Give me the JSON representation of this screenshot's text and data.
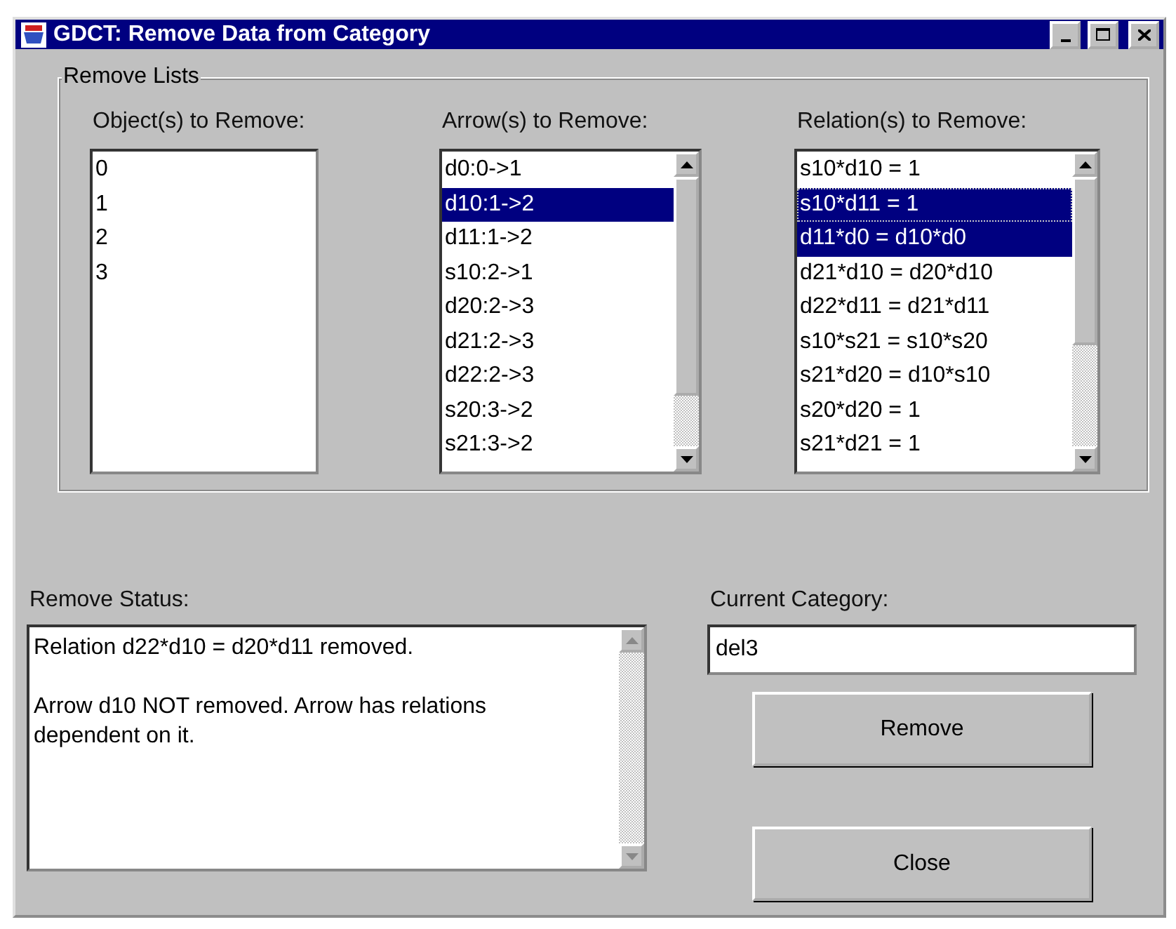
{
  "window": {
    "title": "GDCT: Remove Data from Category"
  },
  "remove_lists": {
    "title": "Remove Lists",
    "objects": {
      "label": "Object(s) to Remove:",
      "items": [
        {
          "text": "0",
          "selected": false
        },
        {
          "text": "1",
          "selected": false
        },
        {
          "text": "2",
          "selected": false
        },
        {
          "text": "3",
          "selected": false
        }
      ]
    },
    "arrows": {
      "label": "Arrow(s) to Remove:",
      "items": [
        {
          "text": "d0:0->1",
          "selected": false
        },
        {
          "text": "d10:1->2",
          "selected": true
        },
        {
          "text": "d11:1->2",
          "selected": false
        },
        {
          "text": "s10:2->1",
          "selected": false
        },
        {
          "text": "d20:2->3",
          "selected": false
        },
        {
          "text": "d21:2->3",
          "selected": false
        },
        {
          "text": "d22:2->3",
          "selected": false
        },
        {
          "text": "s20:3->2",
          "selected": false
        },
        {
          "text": "s21:3->2",
          "selected": false
        }
      ]
    },
    "relations": {
      "label": "Relation(s) to Remove:",
      "items": [
        {
          "text": "s10*d10 = 1",
          "selected": false,
          "focused": false
        },
        {
          "text": "s10*d11 = 1",
          "selected": true,
          "focused": true
        },
        {
          "text": "d11*d0 = d10*d0",
          "selected": true,
          "focused": false
        },
        {
          "text": "d21*d10 = d20*d10",
          "selected": false,
          "focused": false
        },
        {
          "text": "d22*d11 = d21*d11",
          "selected": false,
          "focused": false
        },
        {
          "text": "s10*s21 = s10*s20",
          "selected": false,
          "focused": false
        },
        {
          "text": "s21*d20 = d10*s10",
          "selected": false,
          "focused": false
        },
        {
          "text": "s20*d20 = 1",
          "selected": false,
          "focused": false
        },
        {
          "text": "s21*d21 = 1",
          "selected": false,
          "focused": false
        }
      ]
    }
  },
  "remove_status": {
    "label": "Remove Status:",
    "paragraphs": [
      "Relation d22*d10 = d20*d11 removed.",
      "Arrow d10 NOT removed. Arrow has relations dependent on it."
    ]
  },
  "current_category": {
    "label": "Current Category:",
    "value": "del3"
  },
  "buttons": [
    "Remove",
    "Close"
  ]
}
